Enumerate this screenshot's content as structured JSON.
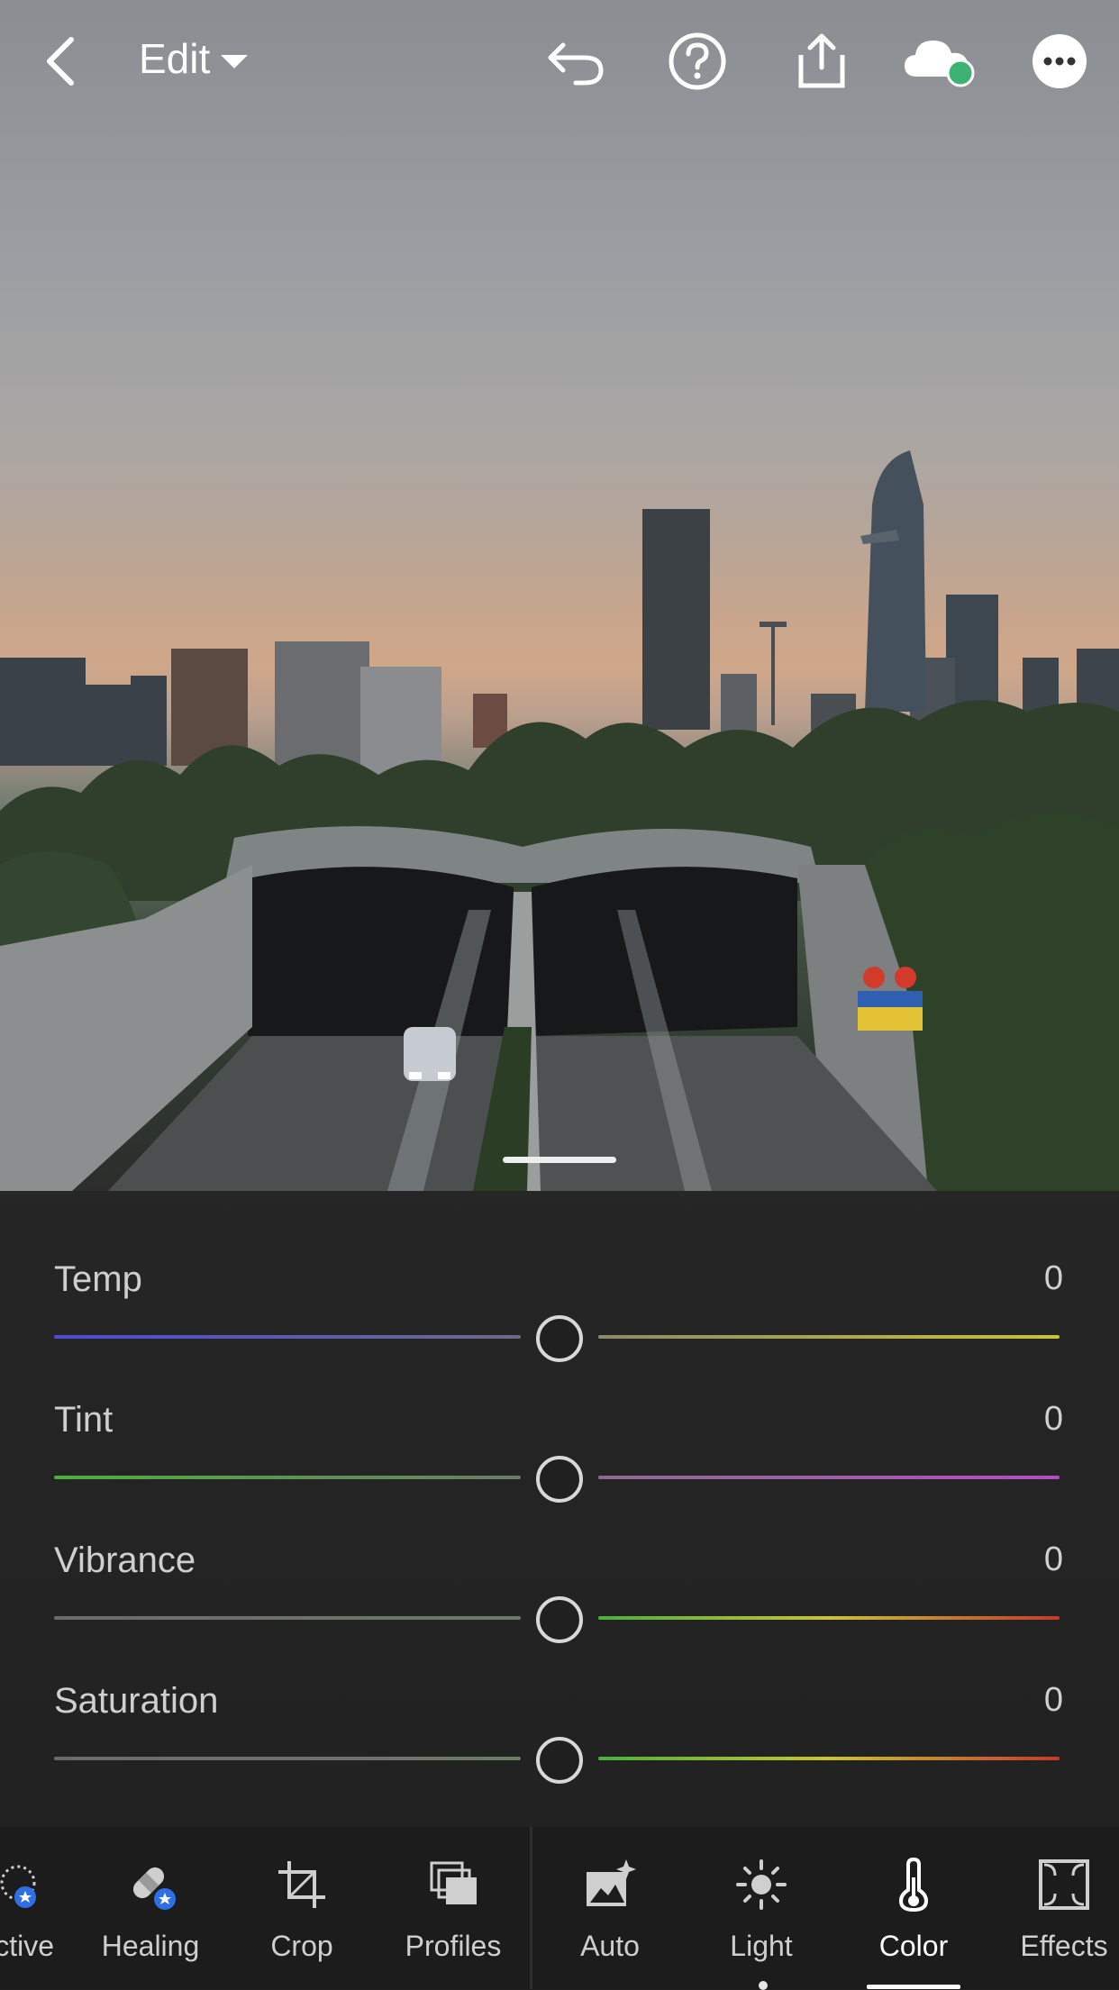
{
  "header": {
    "mode_label": "Edit",
    "icons": [
      "back-arrow-icon",
      "chevron-down-icon",
      "undo-icon",
      "help-icon",
      "share-icon",
      "cloud-sync-icon",
      "more-icon"
    ],
    "sync_status_color": "#3cb371"
  },
  "color_panel": {
    "sliders": [
      {
        "label": "Temp",
        "value": "0",
        "level": 0.5,
        "left_color": "#4b4bd6",
        "right_color": "#c9c23a"
      },
      {
        "label": "Tint",
        "value": "0",
        "level": 0.5,
        "left_color": "#4caf3d",
        "right_color": "#b04bc0"
      },
      {
        "label": "Vibrance",
        "value": "0",
        "level": 0.5,
        "left_color": "#6a6a6a",
        "right_color": "#c33a2a"
      },
      {
        "label": "Saturation",
        "value": "0",
        "level": 0.5,
        "left_color": "#6a6a6a",
        "right_color": "#c33a2a"
      }
    ]
  },
  "toolbar": {
    "tools": [
      {
        "label": "ctive",
        "icon": "selective-icon"
      },
      {
        "label": "Healing",
        "icon": "healing-icon"
      },
      {
        "label": "Crop",
        "icon": "crop-icon"
      },
      {
        "label": "Profiles",
        "icon": "profiles-icon"
      },
      {
        "label": "Auto",
        "icon": "auto-icon"
      },
      {
        "label": "Light",
        "icon": "light-icon"
      },
      {
        "label": "Color",
        "icon": "thermometer-icon",
        "active": true
      },
      {
        "label": "Effects",
        "icon": "effects-icon"
      }
    ],
    "accent_badge_color": "#2f6fe6"
  }
}
